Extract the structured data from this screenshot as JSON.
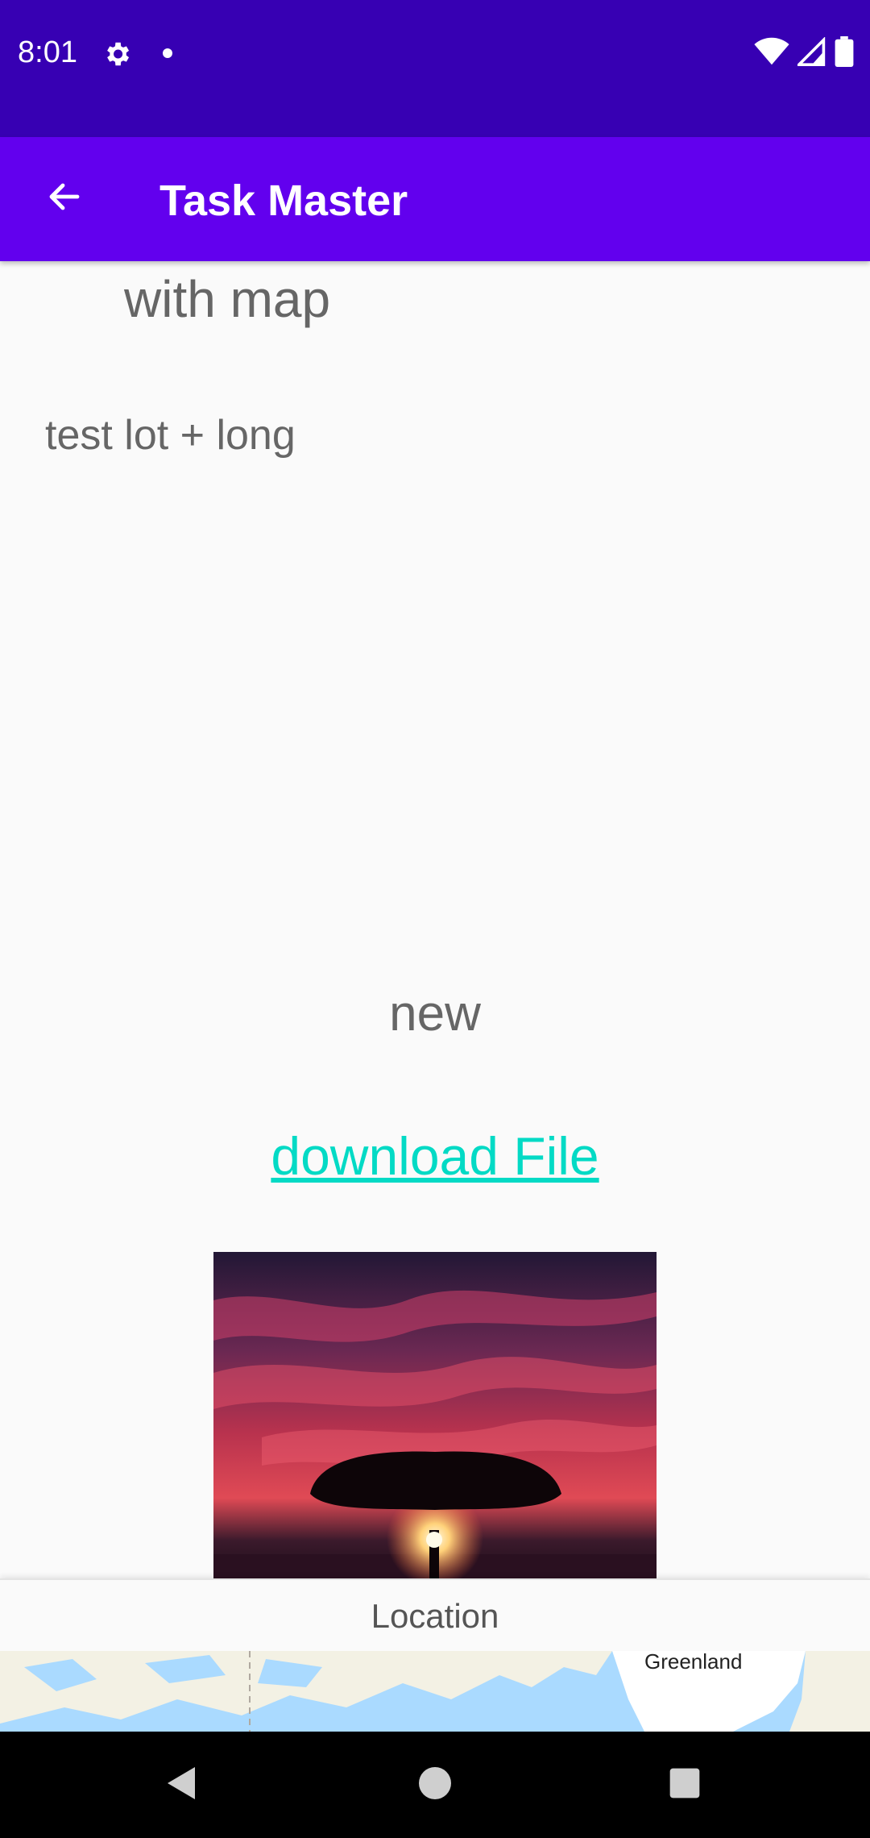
{
  "status_bar": {
    "time": "8:01",
    "icons": [
      "gear-icon",
      "notification-dot-icon",
      "wifi-icon",
      "signal-icon",
      "battery-icon"
    ]
  },
  "app_bar": {
    "title": "Task Master",
    "back_icon": "arrow-back-icon"
  },
  "task": {
    "title": "with map",
    "description": "test lot + long",
    "status": "new",
    "download_link": "download File"
  },
  "location": {
    "label": "Location",
    "map_label": "Greenland"
  },
  "nav_bar": {
    "buttons": [
      "back-triangle-icon",
      "home-circle-icon",
      "recents-square-icon"
    ]
  },
  "colors": {
    "status_bar": "#3700b3",
    "app_bar": "#6200ee",
    "link": "#03dac5",
    "text": "#666666"
  }
}
